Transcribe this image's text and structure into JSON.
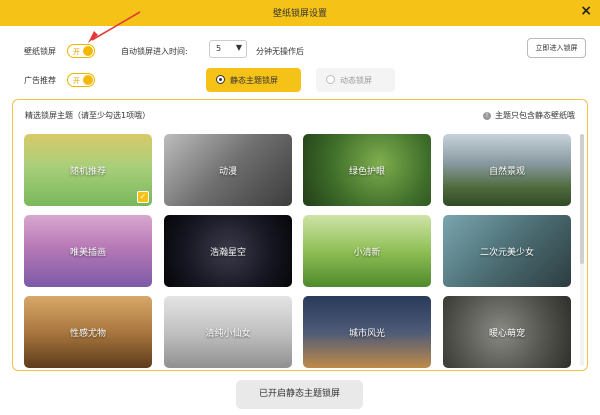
{
  "window": {
    "title": "壁纸锁屏设置",
    "close_glyph": "×"
  },
  "settings": {
    "lock_label": "壁纸锁屏",
    "lock_toggle": "开",
    "ad_label": "广告推荐",
    "ad_toggle": "开",
    "auto_label": "自动锁屏进入时间:",
    "auto_value": "5",
    "auto_suffix": "分钟无操作后",
    "enter_button": "立即进入锁屏"
  },
  "modes": [
    {
      "label": "静态主题锁屏",
      "selected": true
    },
    {
      "label": "动态锁屏",
      "selected": false
    }
  ],
  "panel": {
    "title": "精选锁屏主题（请至少勾选1项哦）",
    "note": "主题只包含静态壁纸哦",
    "info_glyph": "!"
  },
  "themes": [
    {
      "label": "随机推荐",
      "checked": true
    },
    {
      "label": "动漫",
      "checked": false
    },
    {
      "label": "绿色护眼",
      "checked": false
    },
    {
      "label": "自然景观",
      "checked": false
    },
    {
      "label": "唯美插画",
      "checked": false
    },
    {
      "label": "浩瀚星空",
      "checked": false
    },
    {
      "label": "小清新",
      "checked": false
    },
    {
      "label": "二次元美少女",
      "checked": false
    },
    {
      "label": "性感尤物",
      "checked": false
    },
    {
      "label": "清纯小仙女",
      "checked": false
    },
    {
      "label": "城市风光",
      "checked": false
    },
    {
      "label": "暖心萌宠",
      "checked": false
    }
  ],
  "check_glyph": "✓",
  "bottom_button": "已开启静态主题锁屏",
  "colors": {
    "accent": "#f5c218",
    "panel_border": "#f0c24a"
  }
}
